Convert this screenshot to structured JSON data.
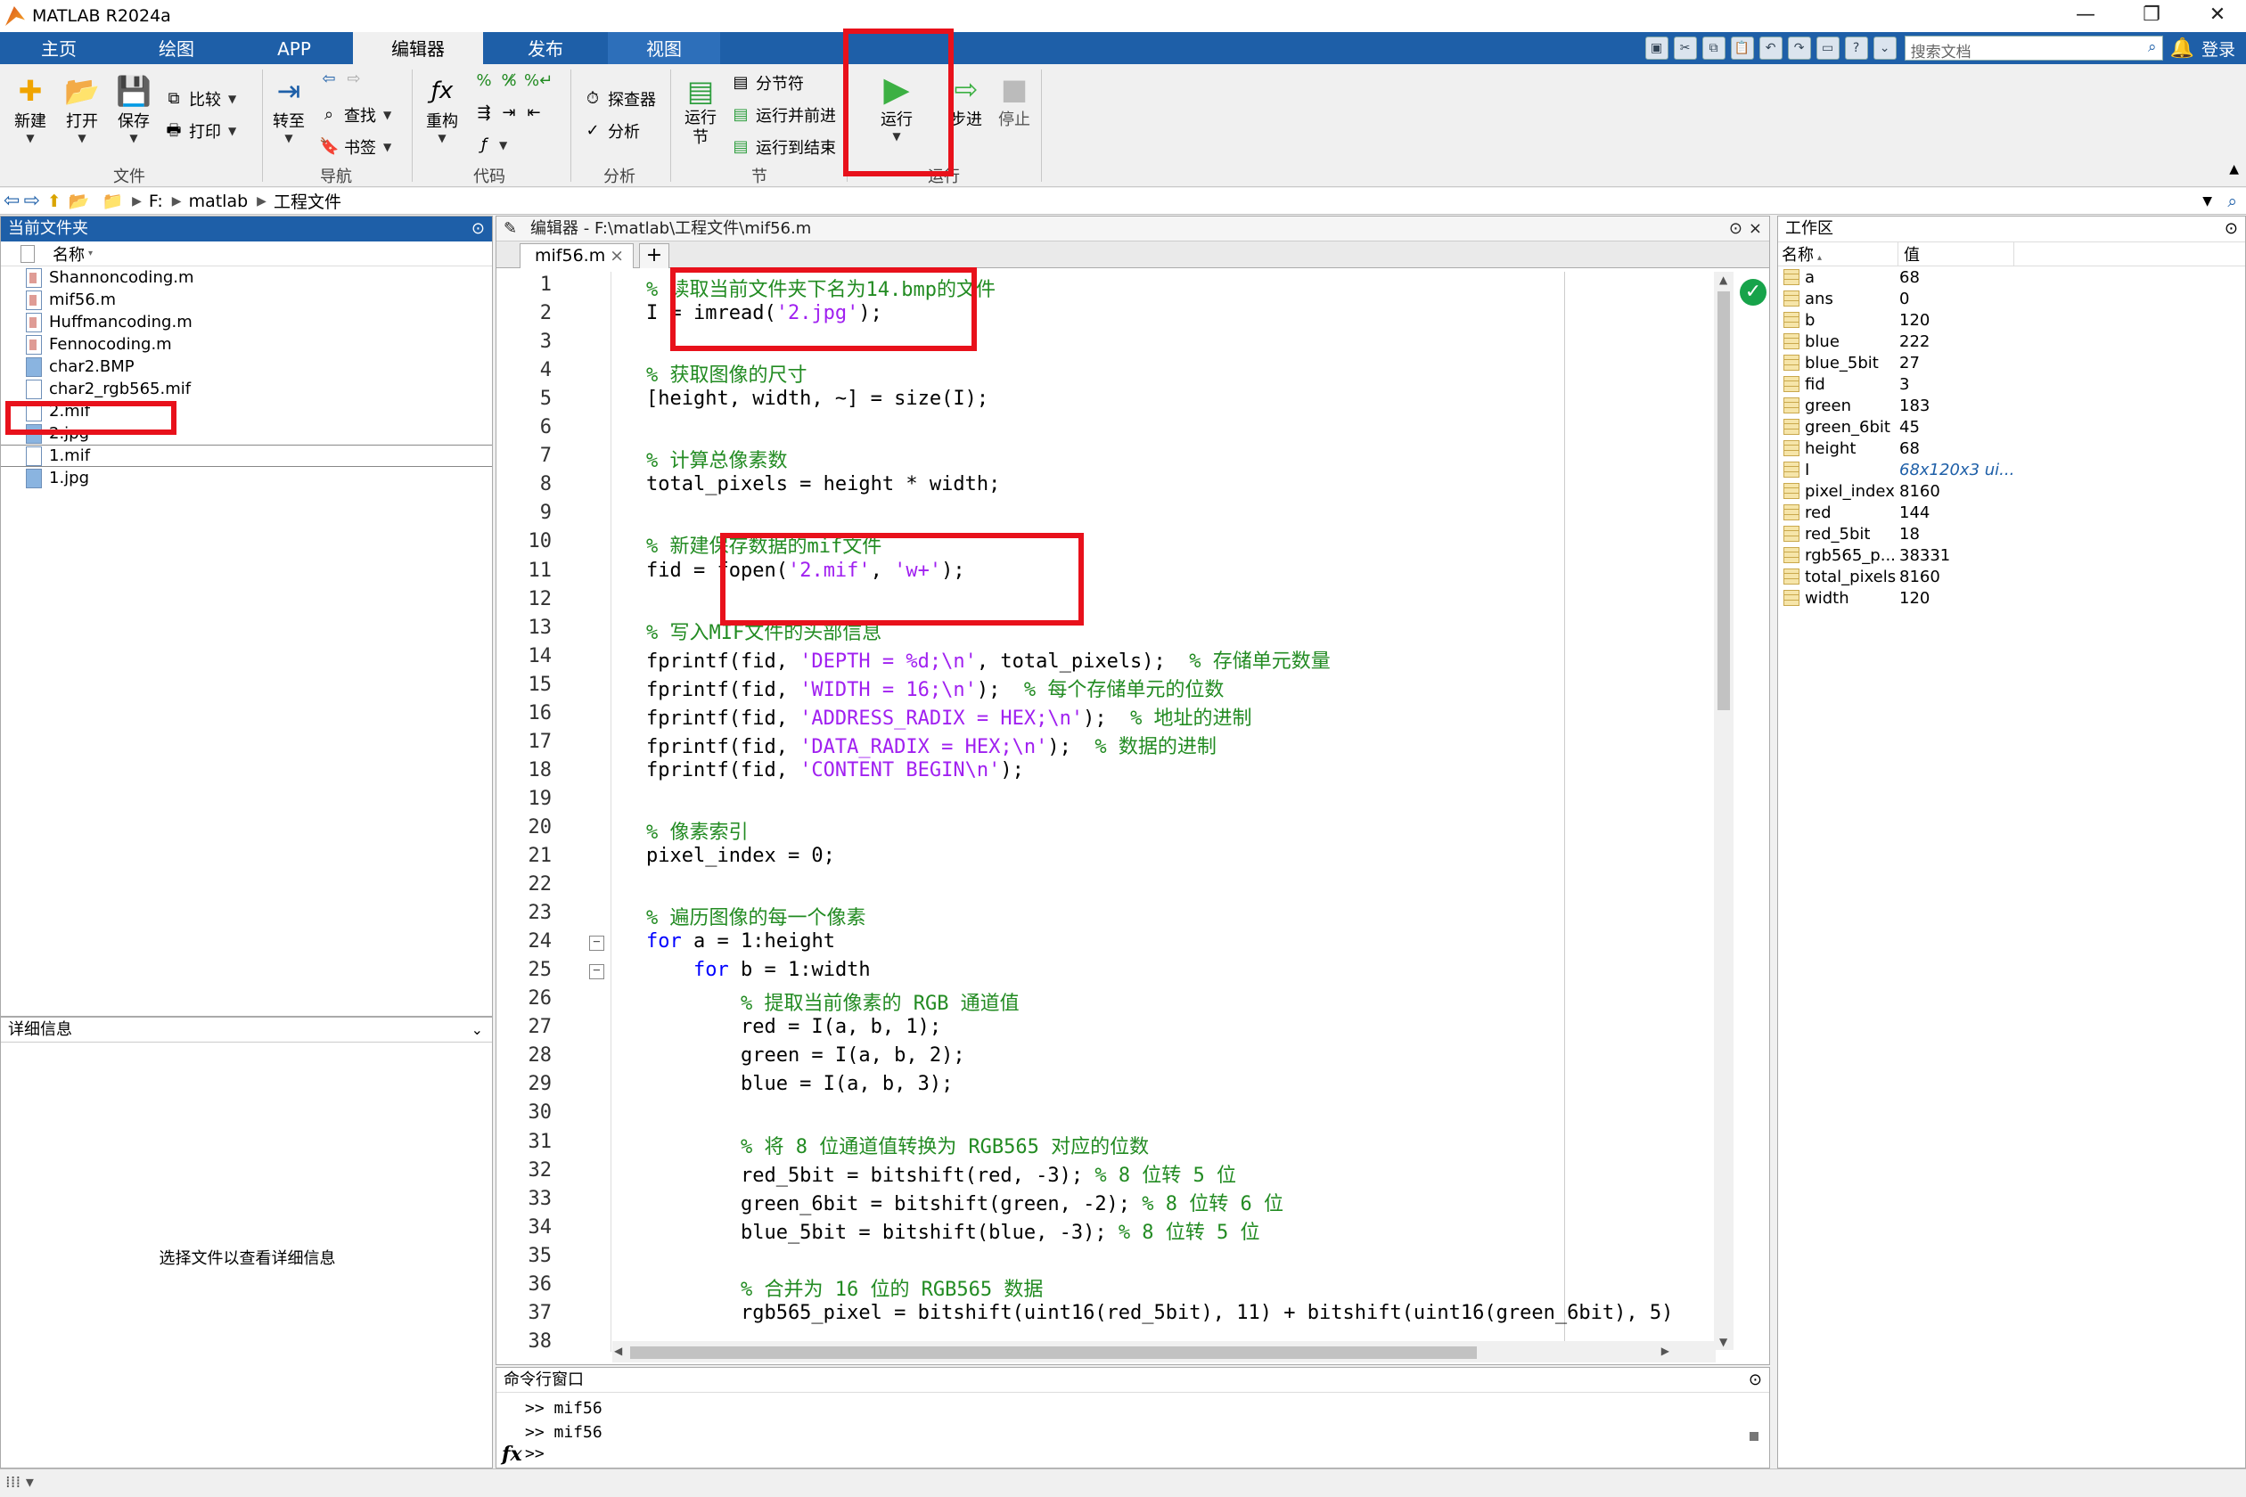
{
  "window": {
    "title": "MATLAB R2024a",
    "minimize": "—",
    "restore": "❐",
    "close": "✕"
  },
  "tabs": [
    "主页",
    "绘图",
    "APP",
    "编辑器",
    "发布",
    "视图"
  ],
  "quick_access": {
    "search_placeholder": "搜索文档",
    "login": "登录"
  },
  "ribbon": {
    "file": {
      "new": "新建",
      "open": "打开",
      "save": "保存",
      "compare": "比较",
      "print": "打印",
      "group": "文件"
    },
    "nav": {
      "goto": "转至",
      "find": "查找",
      "bookmark": "书签",
      "group": "导航"
    },
    "code": {
      "refactor": "重构",
      "group": "代码"
    },
    "analyze": {
      "profiler": "探查器",
      "analyze": "分析",
      "group": "分析"
    },
    "section": {
      "run_section": "运行节",
      "section_break": "分节符",
      "run_advance": "运行并前进",
      "run_to_end": "运行到结束",
      "group": "节"
    },
    "run": {
      "run": "运行",
      "step": "步进",
      "stop": "停止",
      "group": "运行"
    }
  },
  "address": {
    "drive": "F:",
    "folder1": "matlab",
    "folder2": "工程文件"
  },
  "current_folder": {
    "title": "当前文件夹",
    "name_col": "名称",
    "files": [
      {
        "name": "Shannoncoding.m",
        "type": "m"
      },
      {
        "name": "mif56.m",
        "type": "m"
      },
      {
        "name": "Huffmancoding.m",
        "type": "m"
      },
      {
        "name": "Fennocoding.m",
        "type": "m"
      },
      {
        "name": "char2.BMP",
        "type": "img"
      },
      {
        "name": "char2_rgb565.mif",
        "type": "doc"
      },
      {
        "name": "2.mif",
        "type": "doc"
      },
      {
        "name": "2.jpg",
        "type": "img"
      },
      {
        "name": "1.mif",
        "type": "doc"
      },
      {
        "name": "1.jpg",
        "type": "img"
      }
    ]
  },
  "details": {
    "title": "详细信息",
    "empty_text": "选择文件以查看详细信息"
  },
  "editor": {
    "header": "编辑器 - F:\\matlab\\工程文件\\mif56.m",
    "tab": "mif56.m",
    "add_tab": "+",
    "lines": [
      "% 读取当前文件夹下名为14.bmp的文件",
      "I = imread('2.jpg');",
      "",
      "% 获取图像的尺寸",
      "[height, width, ~] = size(I);",
      "",
      "% 计算总像素数",
      "total_pixels = height * width;",
      "",
      "% 新建保存数据的mif文件",
      "fid = fopen('2.mif', 'w+');",
      "",
      "% 写入MIF文件的头部信息",
      "fprintf(fid, 'DEPTH = %d;\\n', total_pixels);  % 存储单元数量",
      "fprintf(fid, 'WIDTH = 16;\\n');  % 每个存储单元的位数",
      "fprintf(fid, 'ADDRESS_RADIX = HEX;\\n');  % 地址的进制",
      "fprintf(fid, 'DATA_RADIX = HEX;\\n');  % 数据的进制",
      "fprintf(fid, 'CONTENT BEGIN\\n');",
      "",
      "% 像素索引",
      "pixel_index = 0;",
      "",
      "% 遍历图像的每一个像素",
      "for a = 1:height",
      "    for b = 1:width",
      "        % 提取当前像素的 RGB 通道值",
      "        red = I(a, b, 1);",
      "        green = I(a, b, 2);",
      "        blue = I(a, b, 3);",
      "",
      "        % 将 8 位通道值转换为 RGB565 对应的位数",
      "        red_5bit = bitshift(red, -3); % 8 位转 5 位",
      "        green_6bit = bitshift(green, -2); % 8 位转 6 位",
      "        blue_5bit = bitshift(blue, -3); % 8 位转 5 位",
      "",
      "        % 合并为 16 位的 RGB565 数据",
      "        rgb565_pixel = bitshift(uint16(red_5bit), 11) + bitshift(uint16(green_6bit), 5)",
      ""
    ]
  },
  "command_window": {
    "title": "命令行窗口",
    "history": [
      ">> mif56",
      ">> mif56"
    ],
    "prompt": ">>",
    "fx": "fx"
  },
  "workspace": {
    "title": "工作区",
    "name_col": "名称",
    "value_col": "值",
    "vars": [
      {
        "name": "a",
        "value": "68"
      },
      {
        "name": "ans",
        "value": "0"
      },
      {
        "name": "b",
        "value": "120"
      },
      {
        "name": "blue",
        "value": "222"
      },
      {
        "name": "blue_5bit",
        "value": "27"
      },
      {
        "name": "fid",
        "value": "3"
      },
      {
        "name": "green",
        "value": "183"
      },
      {
        "name": "green_6bit",
        "value": "45"
      },
      {
        "name": "height",
        "value": "68"
      },
      {
        "name": "I",
        "value": "68x120x3 ui..."
      },
      {
        "name": "pixel_index",
        "value": "8160"
      },
      {
        "name": "red",
        "value": "144"
      },
      {
        "name": "red_5bit",
        "value": "18"
      },
      {
        "name": "rgb565_p...",
        "value": "38331"
      },
      {
        "name": "total_pixels",
        "value": "8160"
      },
      {
        "name": "width",
        "value": "120"
      }
    ]
  },
  "colors": {
    "tab_blue": "#1e5fa8",
    "comment": "#228b22",
    "string": "#a020f0",
    "keyword": "#0000ff",
    "highlight": "#e8111b"
  }
}
